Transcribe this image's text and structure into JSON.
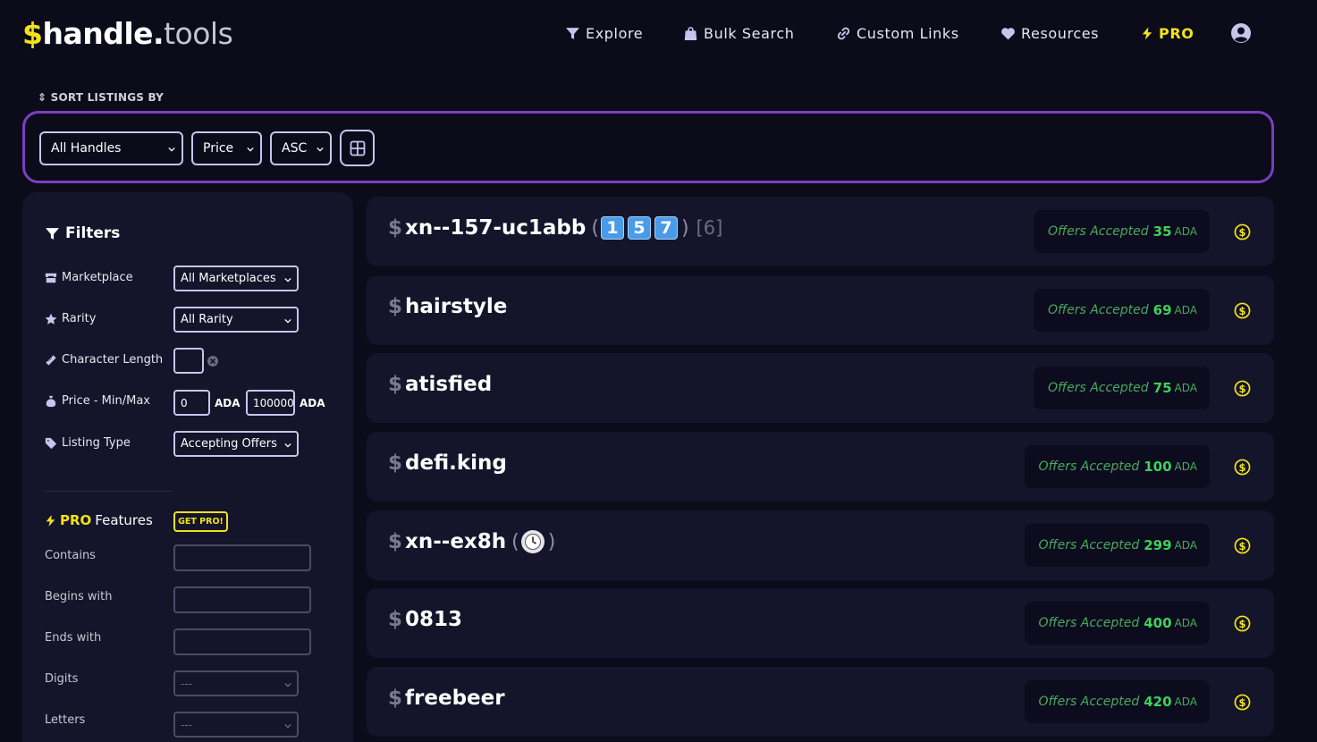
{
  "header": {
    "logo": {
      "dollar": "$",
      "name": "handle.",
      "tld": "tools"
    },
    "nav": [
      {
        "label": "Explore",
        "icon": "filter-icon"
      },
      {
        "label": "Bulk Search",
        "icon": "bag-icon"
      },
      {
        "label": "Custom Links",
        "icon": "link-icon"
      },
      {
        "label": "Resources",
        "icon": "heart-icon"
      },
      {
        "label": "PRO",
        "icon": "bolt-icon"
      }
    ]
  },
  "sort": {
    "label": "SORT LISTINGS BY",
    "handles": "All Handles",
    "field": "Price",
    "order": "ASC"
  },
  "filters": {
    "title": "Filters",
    "marketplace_label": "Marketplace",
    "marketplace_value": "All Marketplaces",
    "rarity_label": "Rarity",
    "rarity_value": "All Rarity",
    "length_label": "Character Length",
    "price_label": "Price - Min/Max",
    "price_min": "0",
    "price_max": "100000(",
    "price_unit": "ADA",
    "listing_type_label": "Listing Type",
    "listing_type_value": "Accepting Offers"
  },
  "pro": {
    "title_pro": "PRO",
    "title_rest": "Features",
    "get_pro": "GET PRO!",
    "contains_label": "Contains",
    "begins_label": "Begins with",
    "ends_label": "Ends with",
    "digits_label": "Digits",
    "digits_value": "---",
    "letters_label": "Letters",
    "letters_value": "---"
  },
  "listings": [
    {
      "name": "xn--157-uc1abb",
      "emoji": [
        "1",
        "5",
        "7"
      ],
      "count": "[6]",
      "offer_text": "Offers Accepted",
      "amount": "35",
      "unit": "ADA"
    },
    {
      "name": "hairstyle",
      "offer_text": "Offers Accepted",
      "amount": "69",
      "unit": "ADA"
    },
    {
      "name": "atisfied",
      "offer_text": "Offers Accepted",
      "amount": "75",
      "unit": "ADA"
    },
    {
      "name": "defi.king",
      "offer_text": "Offers Accepted",
      "amount": "100",
      "unit": "ADA"
    },
    {
      "name": "xn--ex8h",
      "emoji_icon": "clock-emoji",
      "offer_text": "Offers Accepted",
      "amount": "299",
      "unit": "ADA"
    },
    {
      "name": "0813",
      "offer_text": "Offers Accepted",
      "amount": "400",
      "unit": "ADA"
    },
    {
      "name": "freebeer",
      "offer_text": "Offers Accepted",
      "amount": "420",
      "unit": "ADA"
    }
  ],
  "colors": {
    "accent": "#f2e318",
    "border": "#7a3fc1",
    "offer": "#3ed15a"
  }
}
